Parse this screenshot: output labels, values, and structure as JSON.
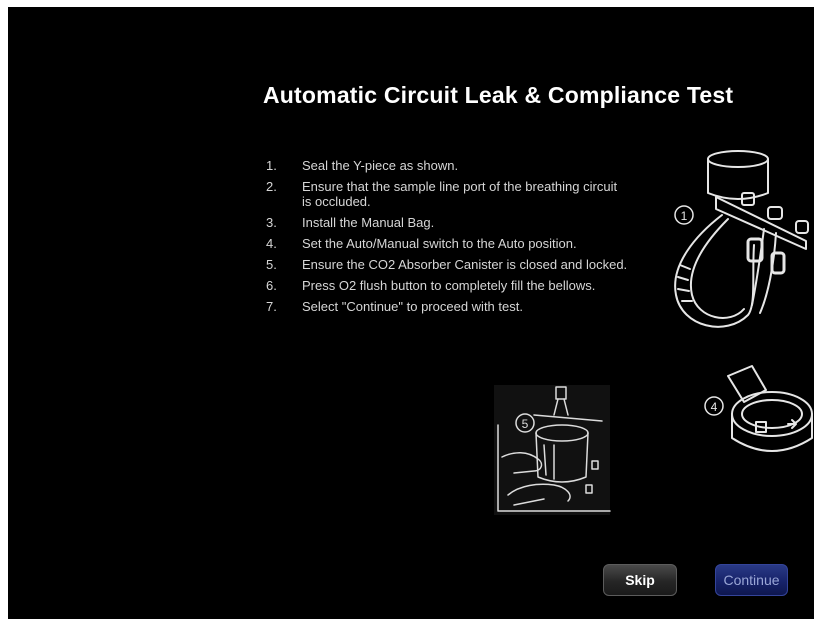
{
  "dialog": {
    "title": "Automatic Circuit Leak & Compliance Test"
  },
  "steps": [
    {
      "num": "1.",
      "text": "Seal the Y-piece as shown."
    },
    {
      "num": "2.",
      "text": "Ensure that the sample line port of the breathing circuit is occluded."
    },
    {
      "num": "3.",
      "text": "Install the Manual Bag."
    },
    {
      "num": "4.",
      "text": "Set the Auto/Manual switch to the Auto position."
    },
    {
      "num": "5.",
      "text": "Ensure the CO2 Absorber Canister is closed and locked."
    },
    {
      "num": "6.",
      "text": "Press O2 flush button to completely fill the bellows."
    },
    {
      "num": "7.",
      "text": "Select \"Continue\" to proceed with test."
    }
  ],
  "illustrations": {
    "circuit": {
      "callout": "1",
      "icon": "breathing-circuit-icon"
    },
    "switch": {
      "callout": "4",
      "icon": "auto-manual-switch-icon"
    },
    "canister": {
      "callout": "5",
      "icon": "co2-canister-icon"
    }
  },
  "buttons": {
    "skip_label": "Skip",
    "continue_label": "Continue"
  },
  "colors": {
    "background": "#000000",
    "title": "#ffffff",
    "body_text": "#d6d6d6",
    "skip_button": "#2e2e2e",
    "continue_button": "#17236a",
    "continue_text": "#9aa6d6"
  }
}
